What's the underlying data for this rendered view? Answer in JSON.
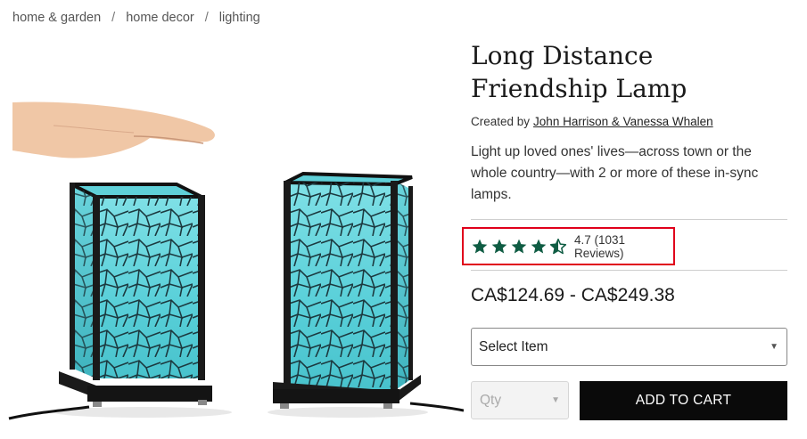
{
  "breadcrumb": {
    "items": [
      "home & garden",
      "home decor",
      "lighting"
    ],
    "separator": "/"
  },
  "product": {
    "title": "Long Distance Friendship Lamp",
    "created_by_label": "Created by",
    "creators": "John Harrison & Vanessa Whalen",
    "description": "Light up loved ones' lives—across town or the whole country—with 2 or more of these in-sync lamps.",
    "rating": {
      "value": 4.7,
      "stars_full": 4,
      "stars_half": 1,
      "text": "4.7 (1031 Reviews)",
      "star_color": "#0f5c43",
      "highlight_color": "#e0001b"
    },
    "price": "CA$124.69 - CA$249.38",
    "image_alt": "Two turquoise mosaic lamps with a hand hovering above one"
  },
  "purchase": {
    "select_item": "Select Item",
    "qty_placeholder": "Qty",
    "add_to_cart": "ADD TO CART"
  },
  "icons": {
    "star": "star-icon",
    "half_star": "half-star-icon",
    "caret": "caret-down-icon"
  }
}
